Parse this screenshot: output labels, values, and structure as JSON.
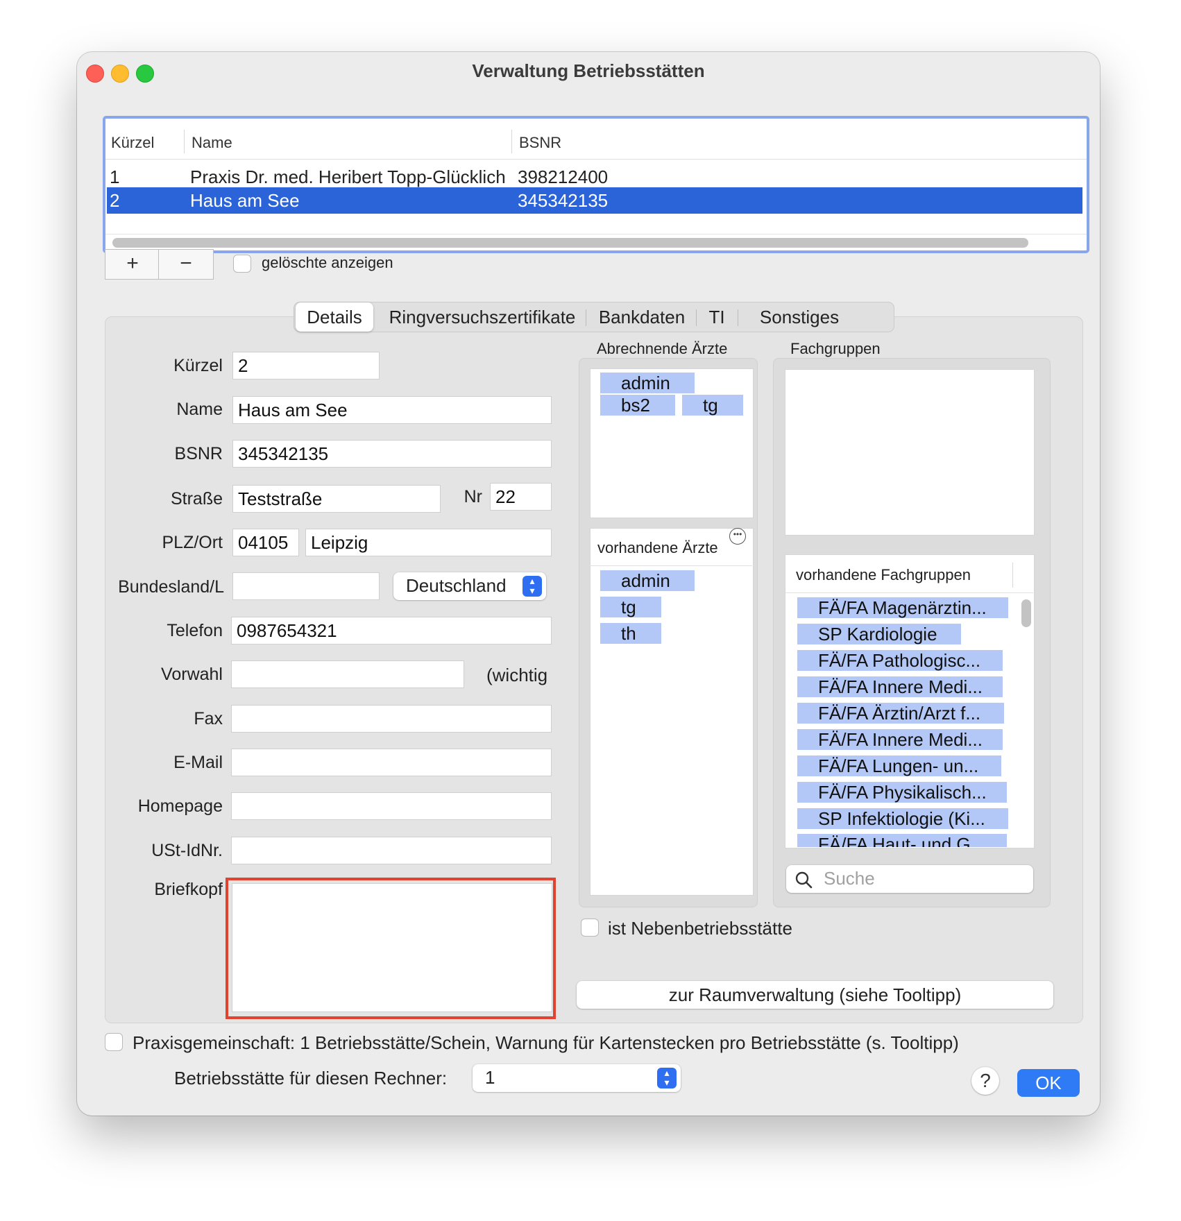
{
  "window": {
    "title": "Verwaltung Betriebsstätten",
    "traffic_lights": {
      "close": "#fe5f57",
      "minimize": "#febc2e",
      "zoom": "#28c840"
    }
  },
  "table": {
    "columns": [
      "Kürzel",
      "Name",
      "BSNR"
    ],
    "rows": [
      {
        "kuerzel": "1",
        "name": "Praxis Dr. med. Heribert Topp-Glücklich",
        "bsnr": "398212400",
        "selected": false
      },
      {
        "kuerzel": "2",
        "name": "Haus am See",
        "bsnr": "345342135",
        "selected": true
      }
    ]
  },
  "table_controls": {
    "add_label": "+",
    "remove_label": "−",
    "show_deleted_label": "gelöschte anzeigen"
  },
  "tabs": [
    "Details",
    "Ringversuchszertifikate",
    "Bankdaten",
    "TI",
    "Sonstiges"
  ],
  "form": {
    "kuerzel": {
      "label": "Kürzel",
      "value": "2"
    },
    "name": {
      "label": "Name",
      "value": "Haus am See"
    },
    "bsnr": {
      "label": "BSNR",
      "value": "345342135"
    },
    "strasse": {
      "label": "Straße",
      "value": "Teststraße"
    },
    "nr": {
      "label": "Nr",
      "value": "22"
    },
    "plz_ort": {
      "label": "PLZ/Ort",
      "plz": "04105",
      "ort": "Leipzig"
    },
    "bundesland": {
      "label": "Bundesland/L",
      "value": "",
      "country": "Deutschland"
    },
    "telefon": {
      "label": "Telefon",
      "value": "0987654321"
    },
    "vorwahl": {
      "label": "Vorwahl",
      "value": "",
      "note": "(wichtig"
    },
    "fax": {
      "label": "Fax",
      "value": ""
    },
    "email": {
      "label": "E-Mail",
      "value": ""
    },
    "homepage": {
      "label": "Homepage",
      "value": ""
    },
    "ust": {
      "label": "USt-IdNr.",
      "value": ""
    },
    "briefkopf": {
      "label": "Briefkopf",
      "value": ""
    }
  },
  "doctors": {
    "billing_title": "Abrechnende Ärzte",
    "billing": [
      "admin",
      "bs2",
      "tg"
    ],
    "available_title": "vorhandene Ärzte",
    "available": [
      "admin",
      "tg",
      "th"
    ]
  },
  "specialties": {
    "title": "Fachgruppen",
    "available_title": "vorhandene Fachgruppen",
    "available": [
      "FÄ/FA Magenärztin...",
      "SP Kardiologie",
      "FÄ/FA Pathologisc...",
      "FÄ/FA Innere Medi...",
      "FÄ/FA Ärztin/Arzt f...",
      "FÄ/FA Innere Medi...",
      "FÄ/FA Lungen- un...",
      "FÄ/FA Physikalisch...",
      "SP Infektiologie (Ki...",
      "FÄ/FA Haut- und G..."
    ],
    "search_placeholder": "Suche"
  },
  "nebenbetriebsstaette_label": "ist Nebenbetriebsstätte",
  "raumverwaltung_label": "zur Raumverwaltung (siehe Tooltipp)",
  "praxisgemeinschaft_label": "Praxisgemeinschaft: 1 Betriebsstätte/Schein, Warnung für Kartenstecken pro Betriebsstätte (s. Tooltipp)",
  "rechner": {
    "label": "Betriebsstätte für diesen Rechner:",
    "value": "1"
  },
  "help_label": "?",
  "ok_label": "OK",
  "colors": {
    "selection": "#2b63d9",
    "chip": "#b3c8f6",
    "accent": "#2f7bf5",
    "highlight_border": "#e1432e"
  }
}
